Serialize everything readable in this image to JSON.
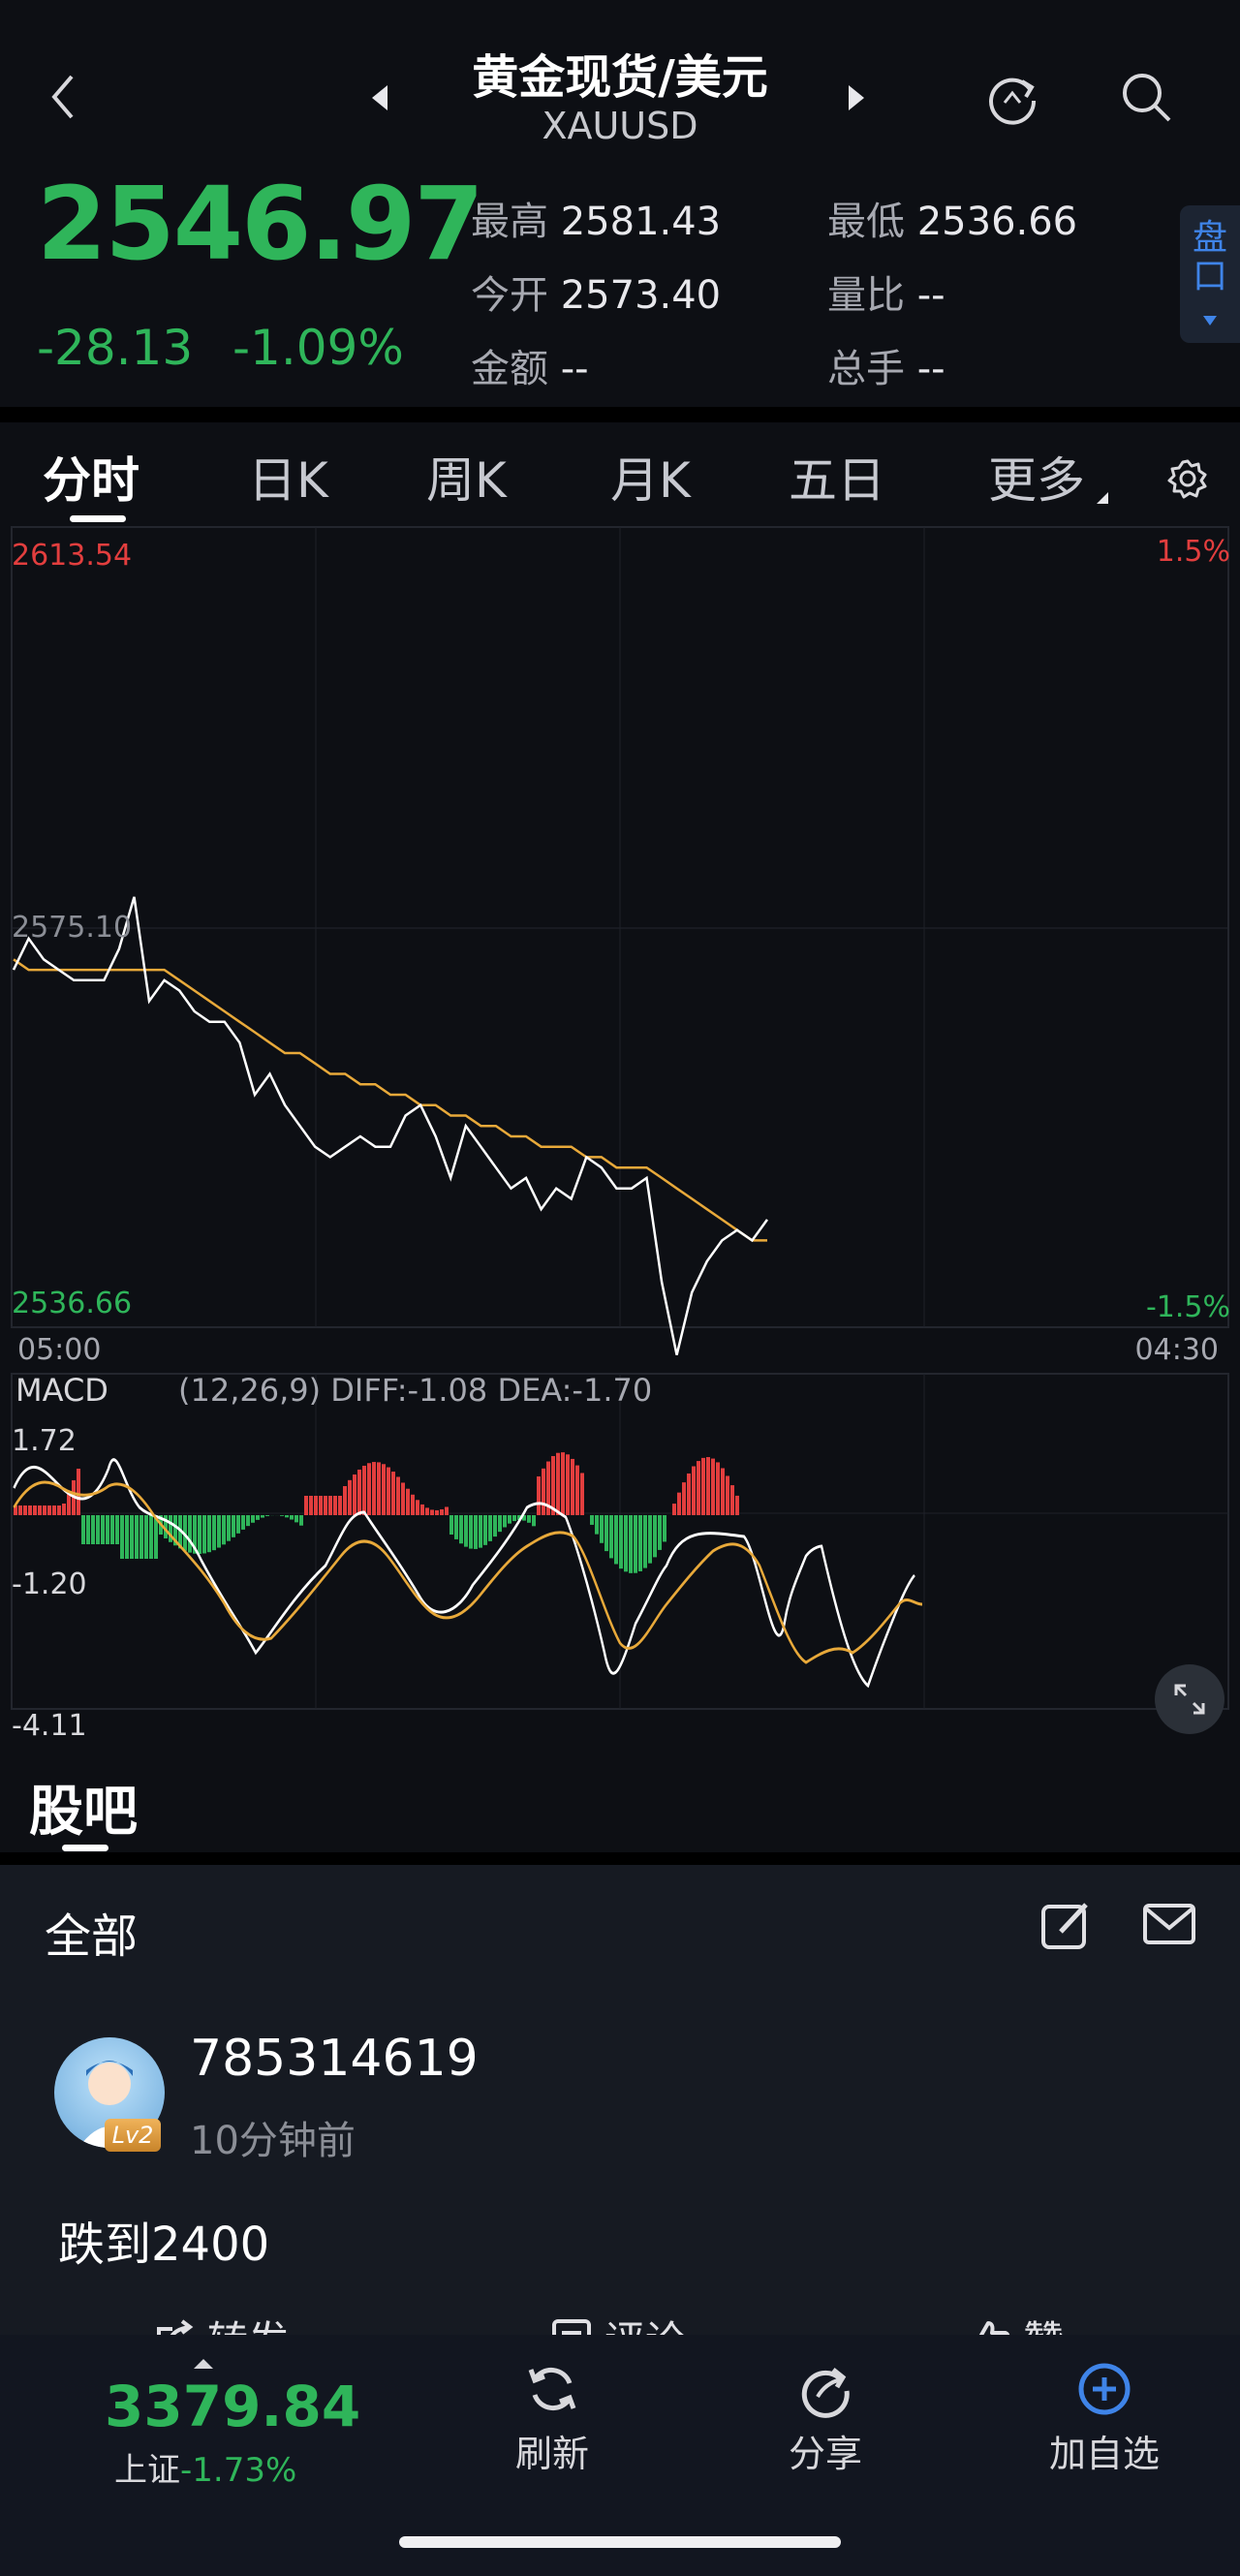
{
  "header": {
    "title": "黄金现货/美元",
    "symbol": "XAUUSD"
  },
  "quote": {
    "price": "2546.97",
    "change": "-28.13",
    "change_pct": "-1.09%",
    "high_label": "最高",
    "high": "2581.43",
    "low_label": "最低",
    "low": "2536.66",
    "open_label": "今开",
    "open": "2573.40",
    "volratio_label": "量比",
    "volratio": "--",
    "amount_label": "金额",
    "amount": "--",
    "turnover_label": "总手",
    "turnover": "--",
    "side_tab_label": "盘口"
  },
  "tabs": [
    "分时",
    "日K",
    "周K",
    "月K",
    "五日",
    "更多"
  ],
  "chart": {
    "top_price": "2613.54",
    "top_pct": "1.5%",
    "mid_price": "2575.10",
    "bottom_price": "2536.66",
    "bottom_pct": "-1.5%",
    "time_start": "05:00",
    "time_end": "04:30",
    "macd_label": "MACD",
    "macd_params": "(12,26,9) DIFF:-1.08 DEA:-1.70",
    "macd_top": "1.72",
    "macd_mid": "-1.20",
    "macd_bottom": "-4.11",
    "colors": {
      "price_line": "#ffffff",
      "avg_line": "#e8a93a",
      "up": "#e23e3e",
      "down": "#2fb55a"
    }
  },
  "chart_data": {
    "type": "line",
    "ylim": [
      2536.66,
      2613.54
    ],
    "series": [
      {
        "values": [
          2571,
          2574,
          2572,
          2571,
          2570,
          2570,
          2570,
          2573,
          2578,
          2568,
          2570,
          2569,
          2567,
          2566,
          2566,
          2564,
          2559,
          2561,
          2558,
          2556,
          2554,
          2553,
          2554,
          2555,
          2554,
          2554,
          2557,
          2558,
          2555,
          2551,
          2556,
          2554,
          2552,
          2550,
          2551,
          2548,
          2550,
          2549,
          2553,
          2552,
          2550,
          2550,
          2551,
          2541,
          2534,
          2540,
          2543,
          2545,
          2546,
          2545,
          2547
        ]
      },
      {
        "values": [
          2572,
          2571,
          2571,
          2571,
          2571,
          2571,
          2571,
          2571,
          2571,
          2571,
          2571,
          2570,
          2569,
          2568,
          2567,
          2566,
          2565,
          2564,
          2563,
          2563,
          2562,
          2561,
          2561,
          2560,
          2560,
          2559,
          2559,
          2558,
          2558,
          2557,
          2557,
          2556,
          2556,
          2555,
          2555,
          2554,
          2554,
          2554,
          2553,
          2553,
          2552,
          2552,
          2552,
          2551,
          2550,
          2549,
          2548,
          2547,
          2546,
          2545,
          2545
        ]
      }
    ]
  },
  "guba": {
    "title": "股吧",
    "filter_label": "全部",
    "post": {
      "user": "785314619",
      "level": "Lv2",
      "time": "10分钟前",
      "content": "跌到2400",
      "forward_label": "转发",
      "comment_label": "评论",
      "like_label": "赞"
    }
  },
  "bottom": {
    "index_value": "3379.84",
    "index_name": "上证",
    "index_change": "-1.73%",
    "refresh_label": "刷新",
    "share_label": "分享",
    "add_label": "加自选"
  }
}
